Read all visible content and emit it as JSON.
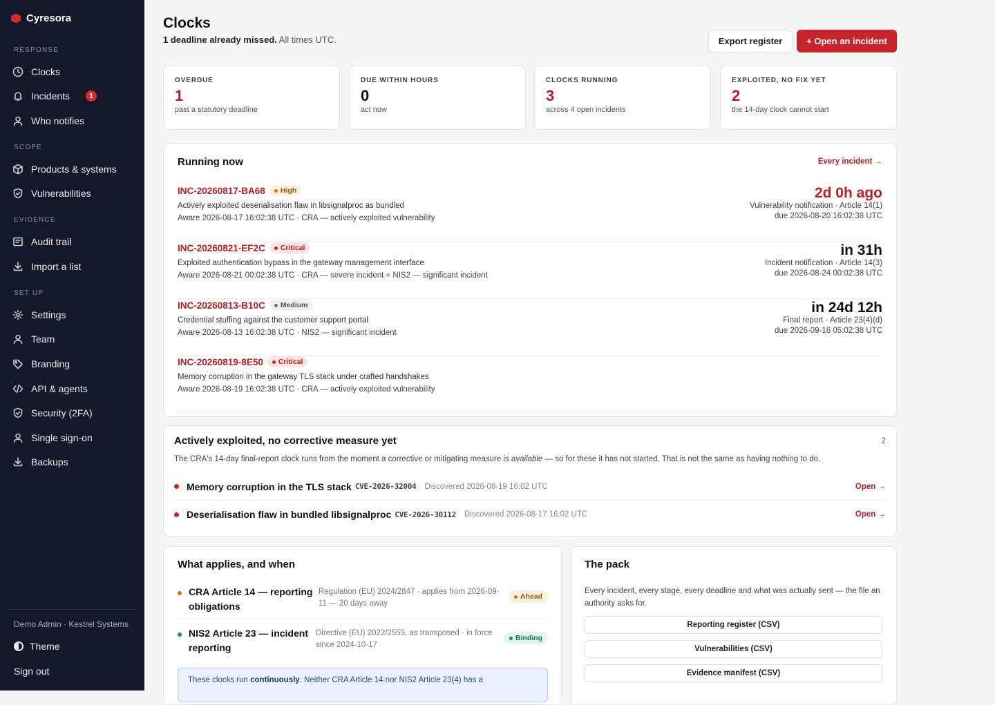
{
  "brand": {
    "name": "Cyresora"
  },
  "sidebar": {
    "sections": [
      {
        "label": "RESPONSE",
        "items": [
          {
            "label": "Clocks",
            "icon": "clock-icon"
          },
          {
            "label": "Incidents",
            "icon": "bell-icon",
            "badge": "1"
          },
          {
            "label": "Who notifies",
            "icon": "person-icon"
          }
        ]
      },
      {
        "label": "SCOPE",
        "items": [
          {
            "label": "Products & systems",
            "icon": "box-icon"
          },
          {
            "label": "Vulnerabilities",
            "icon": "shield-icon"
          }
        ]
      },
      {
        "label": "EVIDENCE",
        "items": [
          {
            "label": "Audit trail",
            "icon": "list-icon"
          },
          {
            "label": "Import a list",
            "icon": "download-icon"
          }
        ]
      },
      {
        "label": "SET UP",
        "items": [
          {
            "label": "Settings",
            "icon": "gear-icon"
          },
          {
            "label": "Team",
            "icon": "person-icon"
          },
          {
            "label": "Branding",
            "icon": "tag-icon"
          },
          {
            "label": "API & agents",
            "icon": "code-icon"
          },
          {
            "label": "Security (2FA)",
            "icon": "shield-icon"
          },
          {
            "label": "Single sign-on",
            "icon": "person-icon"
          },
          {
            "label": "Backups",
            "icon": "download-icon"
          }
        ]
      }
    ],
    "user": "Demo Admin · Kestrel Systems",
    "theme_label": "Theme",
    "signout_label": "Sign out"
  },
  "header": {
    "title": "Clocks",
    "subtitle_bold": "1 deadline already missed.",
    "subtitle_rest": " All times UTC.",
    "export_label": "Export register",
    "open_label": "+ Open an incident"
  },
  "stats": [
    {
      "label": "OVERDUE",
      "value": "1",
      "note": "past a statutory deadline",
      "red": true
    },
    {
      "label": "DUE WITHIN HOURS",
      "value": "0",
      "note": "act now",
      "red": false
    },
    {
      "label": "CLOCKS RUNNING",
      "value": "3",
      "note": "across 4 open incidents",
      "red": true
    },
    {
      "label": "EXPLOITED, NO FIX YET",
      "value": "2",
      "note": "the 14-day clock cannot start",
      "red": true
    }
  ],
  "running": {
    "title": "Running now",
    "link": "Every incident →",
    "incidents": [
      {
        "id": "INC-20260817-BA68",
        "severity": "High",
        "sev_class": "high",
        "desc": "Actively exploited deserialisation flaw in libsignalproc as bundled",
        "meta": "Aware 2026-08-17 16:02:38 UTC · CRA — actively exploited vulnerability",
        "when": "2d 0h ago",
        "overdue": true,
        "kind": "Vulnerability notification · Article 14(1)",
        "due": "due 2026-08-20 16:02:38 UTC"
      },
      {
        "id": "INC-20260821-EF2C",
        "severity": "Critical",
        "sev_class": "critical",
        "desc": "Exploited authentication bypass in the gateway management interface",
        "meta": "Aware 2026-08-21 00:02:38 UTC · CRA — severe incident + NIS2 — significant incident",
        "when": "in 31h",
        "overdue": false,
        "kind": "Incident notification · Article 14(3)",
        "due": "due 2026-08-24 00:02:38 UTC"
      },
      {
        "id": "INC-20260813-B10C",
        "severity": "Medium",
        "sev_class": "medium",
        "desc": "Credential stuffing against the customer support portal",
        "meta": "Aware 2026-08-13 16:02:38 UTC · NIS2 — significant incident",
        "when": "in 24d 12h",
        "overdue": false,
        "kind": "Final report · Article 23(4)(d)",
        "due": "due 2026-09-16 05:02:38 UTC"
      },
      {
        "id": "INC-20260819-8E50",
        "severity": "Critical",
        "sev_class": "critical",
        "desc": "Memory corruption in the gateway TLS stack under crafted handshakes",
        "meta": "Aware 2026-08-19 16:02:38 UTC · CRA — actively exploited vulnerability",
        "when": "",
        "overdue": false,
        "kind": "",
        "due": ""
      }
    ]
  },
  "exploited": {
    "title": "Actively exploited, no corrective measure yet",
    "count": "2",
    "note_pre": "The CRA's 14-day final-report clock runs from the moment a corrective or mitigating measure is ",
    "note_em": "available",
    "note_post": " — so for these it has not started. That is not the same as having nothing to do.",
    "items": [
      {
        "title": "Memory corruption in the TLS stack",
        "cve": "CVE-2026-32004",
        "discovered": "Discovered 2026-08-19 16:02 UTC",
        "open": "Open →"
      },
      {
        "title": "Deserialisation flaw in bundled libsignalproc",
        "cve": "CVE-2026-30112",
        "discovered": "Discovered 2026-08-17 16:02 UTC",
        "open": "Open →"
      }
    ]
  },
  "applies": {
    "title": "What applies, and when",
    "rows": [
      {
        "name": "CRA Article 14 — reporting obligations",
        "detail": "Regulation (EU) 2024/2847 · applies from 2026-09-11 — 20 days away",
        "badge": "Ahead",
        "badge_class": "ahead",
        "dot_color": "#c9761b"
      },
      {
        "name": "NIS2 Article 23 — incident reporting",
        "detail": "Directive (EU) 2022/2555, as transposed · in force since 2024-10-17",
        "badge": "Binding",
        "badge_class": "binding",
        "dot_color": "#1f8b66"
      }
    ],
    "info_pre": "These clocks run ",
    "info_bold": "continuously",
    "info_post": ". Neither CRA Article 14 nor NIS2 Article 23(4) has a"
  },
  "pack": {
    "title": "The pack",
    "desc": "Every incident, every stage, every deadline and what was actually sent — the file an authority asks for.",
    "buttons": [
      "Reporting register (CSV)",
      "Vulnerabilities (CSV)",
      "Evidence manifest (CSV)"
    ]
  },
  "colors": {
    "accent": "#c6242a",
    "sidebar_bg": "#141828",
    "page_bg": "#f5f5f6"
  }
}
